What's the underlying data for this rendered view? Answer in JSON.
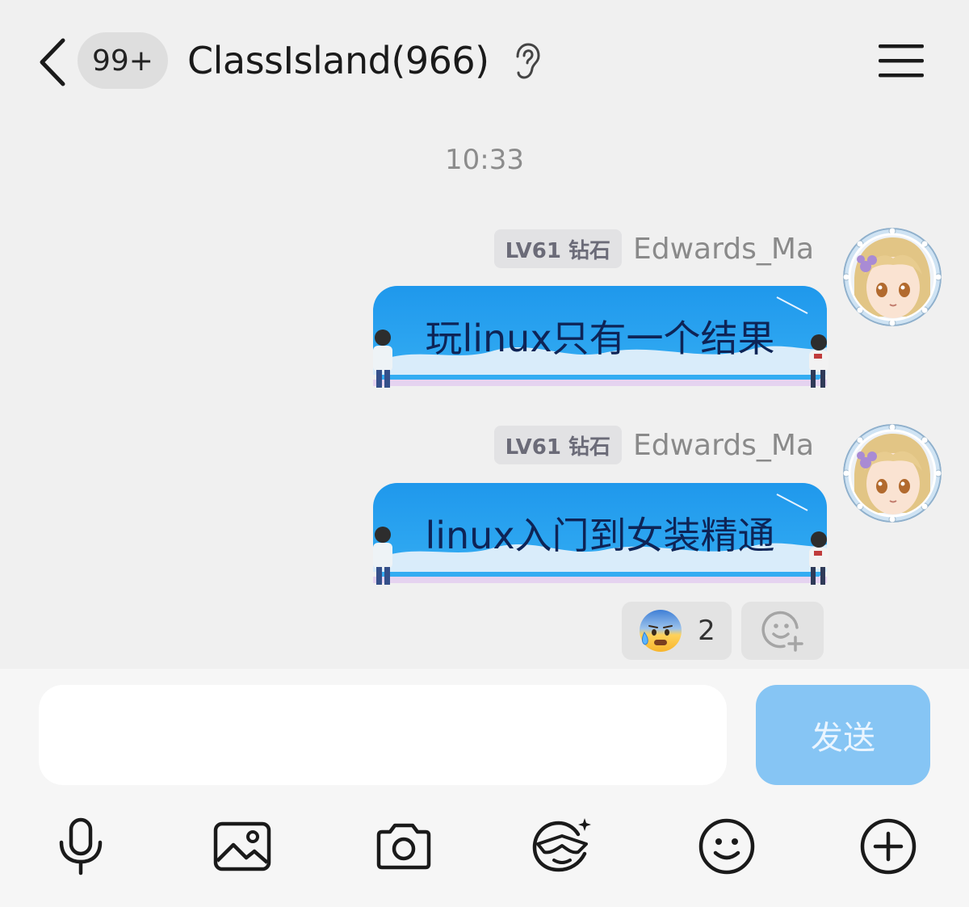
{
  "header": {
    "back_icon": "chevron-left-icon",
    "unread_badge": "99+",
    "title": "ClassIsland(966)",
    "ear_icon": "ear-icon",
    "menu_icon": "hamburger-menu-icon"
  },
  "timestamp": "10:33",
  "messages": [
    {
      "level_badge": "LV61 钻石",
      "sender": "Edwards_Ma",
      "text": "玩linux只有一个结果"
    },
    {
      "level_badge": "LV61 钻石",
      "sender": "Edwards_Ma",
      "text": "linux入门到女装精通"
    }
  ],
  "reaction": {
    "emoji": "😰",
    "count": "2",
    "add_icon": "add-reaction-icon"
  },
  "input": {
    "value": "",
    "send_label": "发送"
  },
  "toolbar": [
    "microphone-icon",
    "image-icon",
    "camera-icon",
    "sticker-icon",
    "emoji-icon",
    "plus-circle-icon"
  ],
  "colors": {
    "send_button": "#86c5f4",
    "bubble_blue": "#2aa1ee",
    "background": "#f0f0f0"
  }
}
